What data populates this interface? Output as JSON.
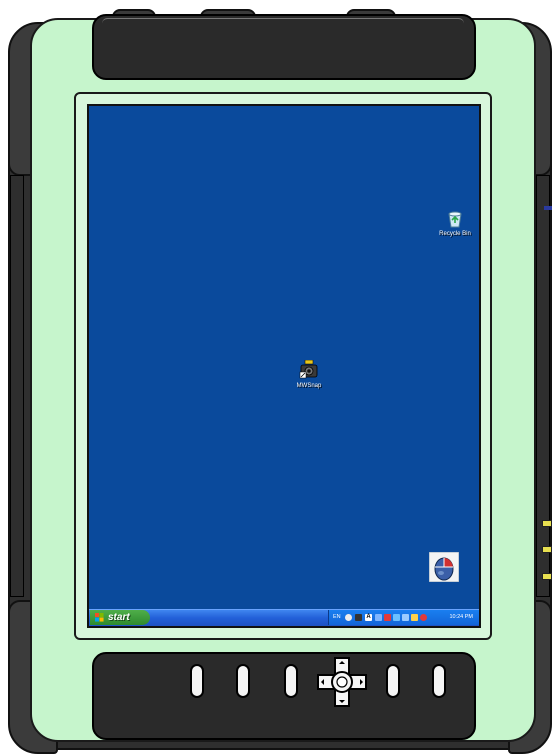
{
  "device": {
    "body_color": "#c6f5cc",
    "frame_color": "#2a2a2a"
  },
  "desktop": {
    "background_color": "#0a4a9c",
    "icons": [
      {
        "label": "Recycle Bin",
        "icon": "recycle-bin-icon"
      },
      {
        "label": "MWSnap",
        "icon": "camera-icon"
      },
      {
        "label": "",
        "icon": "mouse-pointer-app-icon"
      }
    ]
  },
  "taskbar": {
    "start_label": "start",
    "language": "EN",
    "clock": "10:24 PM"
  },
  "hardware_buttons": [
    "button-1",
    "button-2",
    "button-3",
    "dpad",
    "button-4",
    "button-5"
  ]
}
